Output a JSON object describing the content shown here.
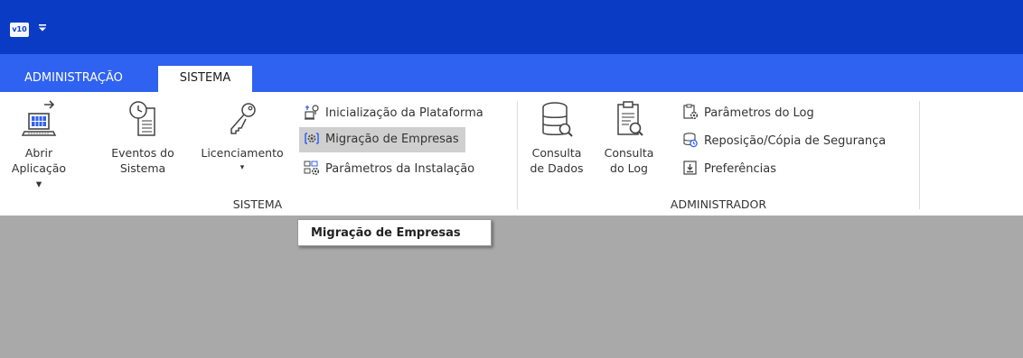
{
  "app": {
    "logo_text": "v10"
  },
  "tabs": [
    {
      "label": "ADMINISTRAÇÃO",
      "active": false
    },
    {
      "label": "SISTEMA",
      "active": true
    }
  ],
  "ribbon": {
    "groups": {
      "sistema": {
        "label": "SISTEMA",
        "big_buttons": [
          {
            "line1": "Abrir",
            "line2": "Aplicação ▾",
            "icon": "laptop-launch-icon"
          },
          {
            "line1": "Eventos do",
            "line2": "Sistema",
            "icon": "clock-document-icon"
          },
          {
            "line1": "Licenciamento",
            "line2": "▾",
            "icon": "key-icon"
          }
        ],
        "small_buttons": [
          {
            "label": "Inicialização da Plataforma",
            "icon": "platform-startup-icon"
          },
          {
            "label": "Migração de Empresas",
            "icon": "migration-gear-icon",
            "hovered": true
          },
          {
            "label": "Parâmetros da Instalação",
            "icon": "installation-params-icon"
          }
        ]
      },
      "administrador": {
        "label": "ADMINISTRADOR",
        "big_buttons": [
          {
            "line1": "Consulta",
            "line2": "de Dados",
            "icon": "database-search-icon"
          },
          {
            "line1": "Consulta",
            "line2": "do Log",
            "icon": "log-search-icon"
          }
        ],
        "small_buttons": [
          {
            "label": "Parâmetros do Log",
            "icon": "log-params-icon"
          },
          {
            "label": "Reposição/Cópia de Segurança",
            "icon": "backup-restore-icon"
          },
          {
            "label": "Preferências",
            "icon": "preferences-icon"
          }
        ]
      }
    }
  },
  "tooltip": {
    "text": "Migração de Empresas"
  },
  "colors": {
    "titlebar": "#0a3bc4",
    "tabsbar": "#2f62f0",
    "workspace": "#a9a9a9",
    "hover": "#cfcfcf"
  }
}
